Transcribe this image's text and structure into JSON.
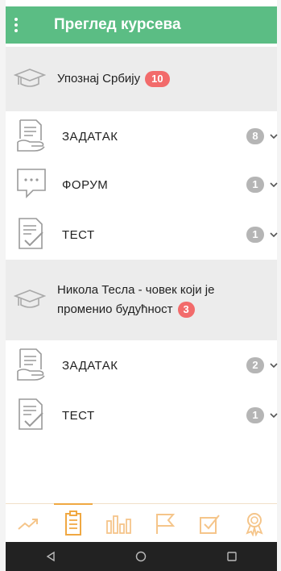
{
  "appbar": {
    "title": "Преглед курсева",
    "menu_icon": "vertical-dots-icon",
    "background_color": "#5bbd84"
  },
  "courses": [
    {
      "title": "Упознај Србију",
      "badge": "10",
      "icon": "graduation-cap-icon",
      "activities": [
        {
          "label": "ЗАДАТАК",
          "count": "8",
          "icon": "assignment-hand-icon"
        },
        {
          "label": "ФОРУМ",
          "count": "1",
          "icon": "chat-bubble-icon"
        },
        {
          "label": "ТЕСТ",
          "count": "1",
          "icon": "checklist-icon"
        }
      ]
    },
    {
      "title_line1": "Никола Тесла - човек који је",
      "title_line2": "променио будућност",
      "badge": "3",
      "icon": "graduation-cap-icon",
      "activities": [
        {
          "label": "ЗАДАТАК",
          "count": "2",
          "icon": "assignment-hand-icon"
        },
        {
          "label": "ТЕСТ",
          "count": "1",
          "icon": "checklist-icon"
        }
      ]
    }
  ],
  "bottom_nav": [
    {
      "icon": "trending-icon",
      "active": false
    },
    {
      "icon": "clipboard-icon",
      "active": true
    },
    {
      "icon": "bar-chart-icon",
      "active": false
    },
    {
      "icon": "flag-icon",
      "active": false
    },
    {
      "icon": "checkbox-icon",
      "active": false
    },
    {
      "icon": "award-icon",
      "active": false
    }
  ],
  "system_nav": [
    "back-icon",
    "home-icon",
    "recents-icon"
  ],
  "colors": {
    "accent": "#f0a842",
    "badge_red": "#f26b6b",
    "badge_grey": "#b5b5b5",
    "section_bg": "#ececec"
  }
}
